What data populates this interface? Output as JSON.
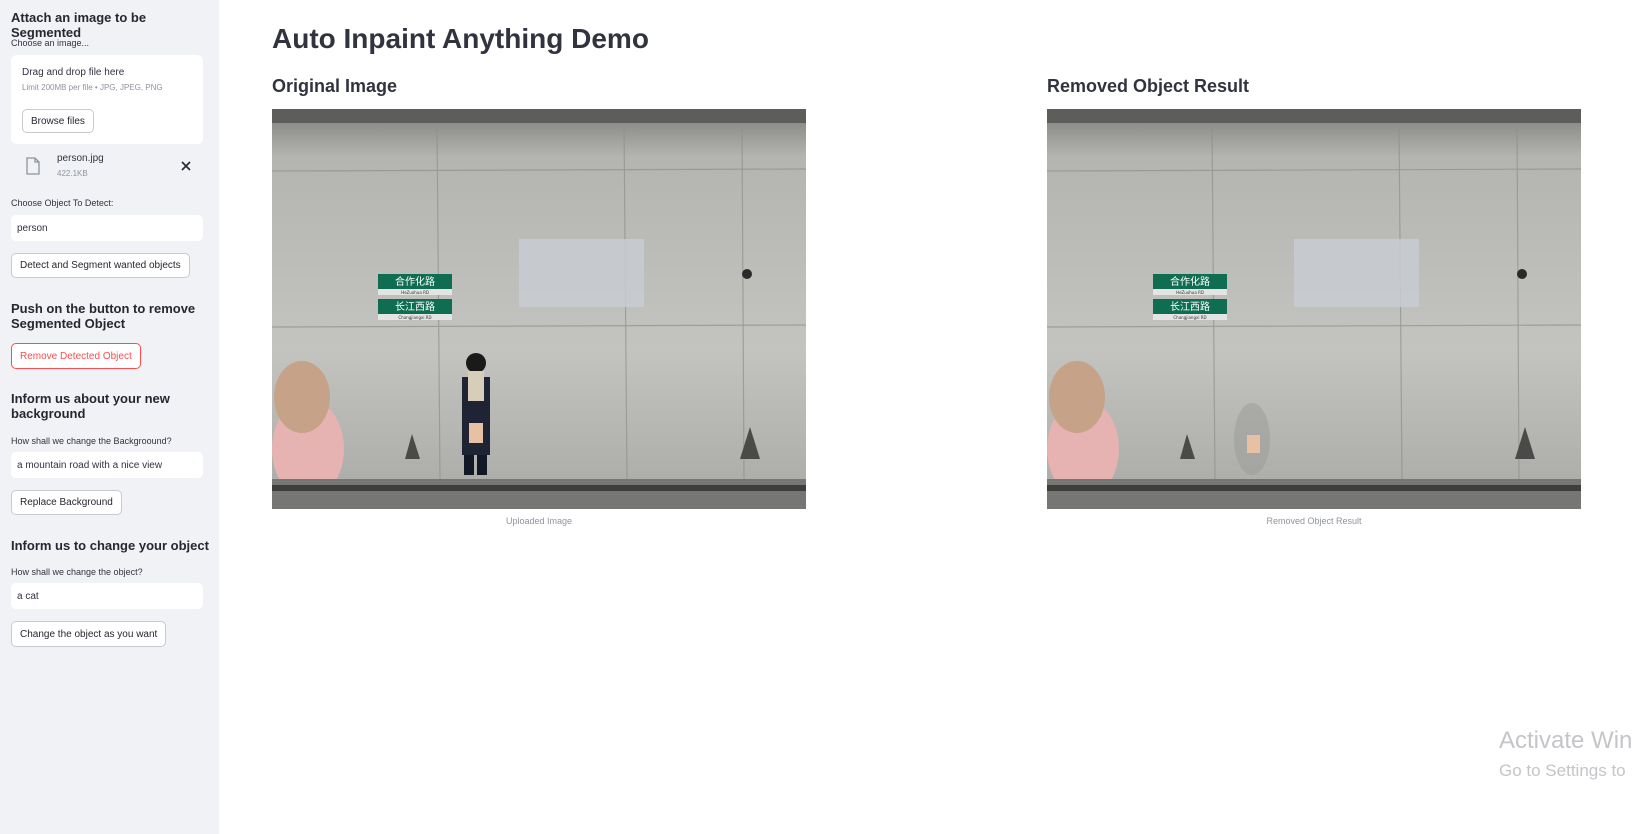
{
  "sidebar": {
    "upload_heading": "Attach an image to be Segmented",
    "choose_label": "Choose an image...",
    "dropzone_title": "Drag and drop file here",
    "dropzone_limit": "Limit 200MB per file • JPG, JPEG, PNG",
    "browse_label": "Browse files",
    "file_name": "person.jpg",
    "file_size": "422.1KB",
    "detect_label": "Choose Object To Detect:",
    "detect_value": "person",
    "detect_button": "Detect and Segment wanted objects",
    "remove_heading": "Push on the button to remove Segmented Object",
    "remove_button": "Remove Detected Object",
    "bg_heading": "Inform us about your new background",
    "bg_label": "How shall we change the Backgroound?",
    "bg_value": "a mountain road with a nice view",
    "bg_button": "Replace Background",
    "obj_heading": "Inform us to change your object",
    "obj_label": "How shall we change the object?",
    "obj_value": "a cat",
    "obj_button": "Change the object as you want"
  },
  "main": {
    "title": "Auto Inpaint Anything Demo",
    "left_title": "Original Image",
    "left_caption": "Uploaded Image",
    "right_title": "Removed Object Result",
    "right_caption": "Removed Object Result"
  },
  "sign": {
    "top": "合作化路",
    "top_sub": "HeZuohua RD",
    "bottom": "长江西路",
    "bottom_sub": "Changjiangxi RD"
  },
  "watermark": {
    "line1": "Activate Win",
    "line2": "Go to Settings to"
  }
}
